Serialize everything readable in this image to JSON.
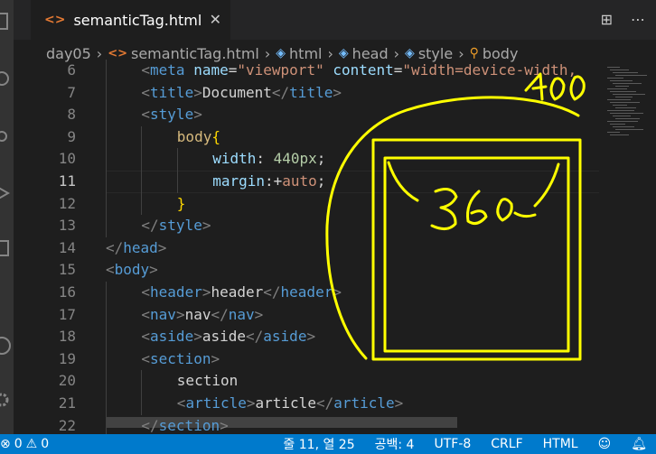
{
  "tab": {
    "icon": "<>",
    "label": "semanticTag.html",
    "close": "✕"
  },
  "tab_actions": [
    "⊞",
    "⋯"
  ],
  "breadcrumb": [
    {
      "icon": "",
      "text": "day05"
    },
    {
      "icon": "<>",
      "text": "semanticTag.html"
    },
    {
      "icon": "◈",
      "text": "html"
    },
    {
      "icon": "◈",
      "text": "head"
    },
    {
      "icon": "◈",
      "text": "style"
    },
    {
      "icon": "⚲",
      "text": "body"
    }
  ],
  "editor": {
    "active_line": "11",
    "lines": [
      {
        "n": "6",
        "indent": 1,
        "tokens": [
          [
            "t-punc",
            "<"
          ],
          [
            "t-tag",
            "meta"
          ],
          [
            "t-text",
            " "
          ],
          [
            "t-attr",
            "name"
          ],
          [
            "t-text",
            "="
          ],
          [
            "t-str",
            "\"viewport\""
          ],
          [
            "t-text",
            " "
          ],
          [
            "t-attr",
            "content"
          ],
          [
            "t-text",
            "="
          ],
          [
            "t-str",
            "\"width=device-width,"
          ]
        ]
      },
      {
        "n": "7",
        "indent": 1,
        "tokens": [
          [
            "t-punc",
            "<"
          ],
          [
            "t-tag",
            "title"
          ],
          [
            "t-punc",
            ">"
          ],
          [
            "t-text",
            "Document"
          ],
          [
            "t-punc",
            "</"
          ],
          [
            "t-tag",
            "title"
          ],
          [
            "t-punc",
            ">"
          ]
        ]
      },
      {
        "n": "8",
        "indent": 1,
        "tokens": [
          [
            "t-punc",
            "<"
          ],
          [
            "t-tag",
            "style"
          ],
          [
            "t-punc",
            ">"
          ]
        ]
      },
      {
        "n": "9",
        "indent": 2,
        "tokens": [
          [
            "t-sel",
            "body"
          ],
          [
            "t-brace",
            "{"
          ]
        ]
      },
      {
        "n": "10",
        "indent": 3,
        "tokens": [
          [
            "t-prop",
            "width"
          ],
          [
            "t-text",
            ": "
          ],
          [
            "t-num",
            "440px"
          ],
          [
            "t-text",
            ";"
          ]
        ]
      },
      {
        "n": "11",
        "indent": 3,
        "tokens": [
          [
            "t-prop",
            "margin"
          ],
          [
            "t-text",
            ":+"
          ],
          [
            "t-str",
            "auto"
          ],
          [
            "t-text",
            ";"
          ]
        ]
      },
      {
        "n": "12",
        "indent": 2,
        "tokens": [
          [
            "t-brace",
            "}"
          ]
        ]
      },
      {
        "n": "13",
        "indent": 1,
        "tokens": [
          [
            "t-punc",
            "</"
          ],
          [
            "t-tag",
            "style"
          ],
          [
            "t-punc",
            ">"
          ]
        ]
      },
      {
        "n": "14",
        "indent": 0,
        "tokens": [
          [
            "t-punc",
            "</"
          ],
          [
            "t-tag",
            "head"
          ],
          [
            "t-punc",
            ">"
          ]
        ]
      },
      {
        "n": "15",
        "indent": 0,
        "tokens": [
          [
            "t-punc",
            "<"
          ],
          [
            "t-tag",
            "body"
          ],
          [
            "t-punc",
            ">"
          ]
        ]
      },
      {
        "n": "16",
        "indent": 1,
        "tokens": [
          [
            "t-punc",
            "<"
          ],
          [
            "t-tag",
            "header"
          ],
          [
            "t-punc",
            ">"
          ],
          [
            "t-text",
            "header"
          ],
          [
            "t-punc",
            "</"
          ],
          [
            "t-tag",
            "header"
          ],
          [
            "t-punc",
            ">"
          ]
        ]
      },
      {
        "n": "17",
        "indent": 1,
        "tokens": [
          [
            "t-punc",
            "<"
          ],
          [
            "t-tag",
            "nav"
          ],
          [
            "t-punc",
            ">"
          ],
          [
            "t-text",
            "nav"
          ],
          [
            "t-punc",
            "</"
          ],
          [
            "t-tag",
            "nav"
          ],
          [
            "t-punc",
            ">"
          ]
        ]
      },
      {
        "n": "18",
        "indent": 1,
        "tokens": [
          [
            "t-punc",
            "<"
          ],
          [
            "t-tag",
            "aside"
          ],
          [
            "t-punc",
            ">"
          ],
          [
            "t-text",
            "aside"
          ],
          [
            "t-punc",
            "</"
          ],
          [
            "t-tag",
            "aside"
          ],
          [
            "t-punc",
            ">"
          ]
        ]
      },
      {
        "n": "19",
        "indent": 1,
        "tokens": [
          [
            "t-punc",
            "<"
          ],
          [
            "t-tag",
            "section"
          ],
          [
            "t-punc",
            ">"
          ]
        ]
      },
      {
        "n": "20",
        "indent": 2,
        "tokens": [
          [
            "t-text",
            "section"
          ]
        ]
      },
      {
        "n": "21",
        "indent": 2,
        "tokens": [
          [
            "t-punc",
            "<"
          ],
          [
            "t-tag",
            "article"
          ],
          [
            "t-punc",
            ">"
          ],
          [
            "t-text",
            "article"
          ],
          [
            "t-punc",
            "</"
          ],
          [
            "t-tag",
            "article"
          ],
          [
            "t-punc",
            ">"
          ]
        ]
      },
      {
        "n": "22",
        "indent": 1,
        "tokens": [
          [
            "t-punc",
            "</"
          ],
          [
            "t-tag",
            "section"
          ],
          [
            "t-punc",
            ">"
          ]
        ]
      }
    ]
  },
  "annotations": {
    "color": "#ffff00",
    "outer_label": "400",
    "inner_label": "360"
  },
  "statusbar": {
    "left_errors": "0",
    "left_warnings": "0",
    "position": "줄 11, 열 25",
    "spaces": "공백: 4",
    "encoding": "UTF-8",
    "eol": "CRLF",
    "language": "HTML"
  },
  "colors": {
    "accent": "#007acc",
    "editor_bg": "#1e1e1e",
    "tag": "#569cd6",
    "string": "#ce9178"
  }
}
